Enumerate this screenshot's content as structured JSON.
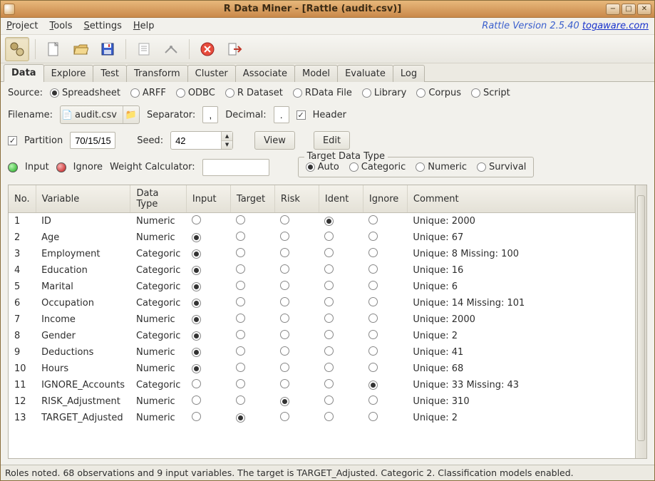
{
  "window": {
    "title": "R Data Miner - [Rattle (audit.csv)]"
  },
  "menus": {
    "project": "Project",
    "tools": "Tools",
    "settings": "Settings",
    "help": "Help"
  },
  "version": {
    "prefix": "Rattle Version 2.5.40 ",
    "link": "togaware.com"
  },
  "tabs": [
    "Data",
    "Explore",
    "Test",
    "Transform",
    "Cluster",
    "Associate",
    "Model",
    "Evaluate",
    "Log"
  ],
  "active_tab": 0,
  "source": {
    "label": "Source:",
    "options": [
      "Spreadsheet",
      "ARFF",
      "ODBC",
      "R Dataset",
      "RData File",
      "Library",
      "Corpus",
      "Script"
    ],
    "selected": 0
  },
  "filename": {
    "label": "Filename:",
    "value": "audit.csv",
    "separator_label": "Separator:",
    "separator": ",",
    "decimal_label": "Decimal:",
    "decimal": ".",
    "header_label": "Header",
    "header_checked": true
  },
  "partition": {
    "checked": true,
    "label": "Partition",
    "value": "70/15/15",
    "seed_label": "Seed:",
    "seed_value": "42",
    "view_btn": "View",
    "edit_btn": "Edit"
  },
  "roles": {
    "input_label": "Input",
    "ignore_label": "Ignore",
    "weight_label": "Weight Calculator:",
    "weight_value": ""
  },
  "target_type": {
    "legend": "Target Data Type",
    "options": [
      "Auto",
      "Categoric",
      "Numeric",
      "Survival"
    ],
    "selected": 0
  },
  "table": {
    "headers": [
      "No.",
      "Variable",
      "Data Type",
      "Input",
      "Target",
      "Risk",
      "Ident",
      "Ignore",
      "Comment"
    ],
    "rows": [
      {
        "no": "1",
        "var": "ID",
        "dt": "Numeric",
        "role": 3,
        "comment": "Unique: 2000"
      },
      {
        "no": "2",
        "var": "Age",
        "dt": "Numeric",
        "role": 0,
        "comment": "Unique: 67"
      },
      {
        "no": "3",
        "var": "Employment",
        "dt": "Categoric",
        "role": 0,
        "comment": "Unique: 8 Missing: 100"
      },
      {
        "no": "4",
        "var": "Education",
        "dt": "Categoric",
        "role": 0,
        "comment": "Unique: 16"
      },
      {
        "no": "5",
        "var": "Marital",
        "dt": "Categoric",
        "role": 0,
        "comment": "Unique: 6"
      },
      {
        "no": "6",
        "var": "Occupation",
        "dt": "Categoric",
        "role": 0,
        "comment": "Unique: 14 Missing: 101"
      },
      {
        "no": "7",
        "var": "Income",
        "dt": "Numeric",
        "role": 0,
        "comment": "Unique: 2000"
      },
      {
        "no": "8",
        "var": "Gender",
        "dt": "Categoric",
        "role": 0,
        "comment": "Unique: 2"
      },
      {
        "no": "9",
        "var": "Deductions",
        "dt": "Numeric",
        "role": 0,
        "comment": "Unique: 41"
      },
      {
        "no": "10",
        "var": "Hours",
        "dt": "Numeric",
        "role": 0,
        "comment": "Unique: 68"
      },
      {
        "no": "11",
        "var": "IGNORE_Accounts",
        "dt": "Categoric",
        "role": 4,
        "comment": "Unique: 33 Missing: 43"
      },
      {
        "no": "12",
        "var": "RISK_Adjustment",
        "dt": "Numeric",
        "role": 2,
        "comment": "Unique: 310"
      },
      {
        "no": "13",
        "var": "TARGET_Adjusted",
        "dt": "Numeric",
        "role": 1,
        "comment": "Unique: 2"
      }
    ]
  },
  "status": "Roles noted. 68 observations and 9 input variables. The target is TARGET_Adjusted. Categoric 2. Classification models enabled."
}
